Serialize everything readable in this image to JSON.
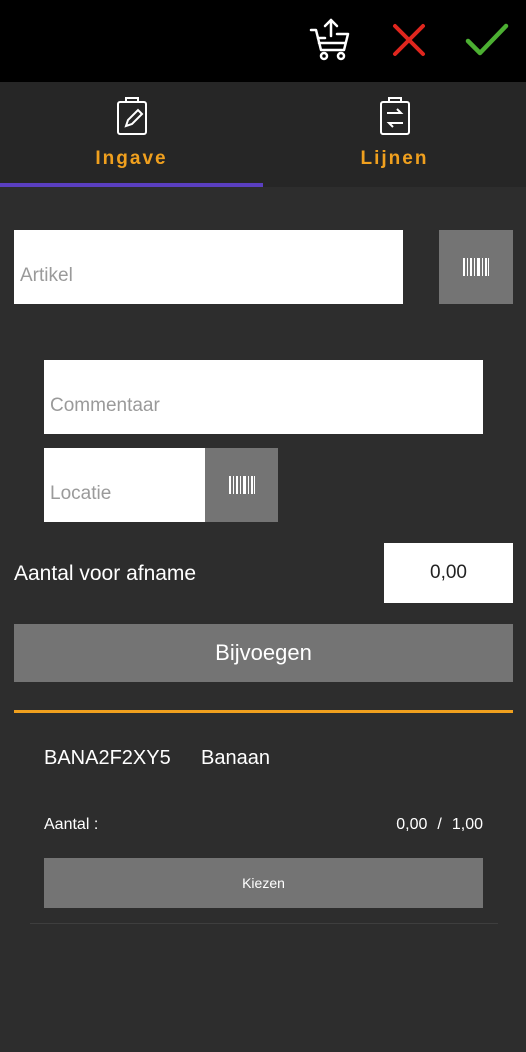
{
  "toolbar": {
    "upload_icon": "cart-upload-icon",
    "cancel_icon": "close-icon",
    "confirm_icon": "checkmark-icon",
    "cancel_color": "#e0261e",
    "confirm_color": "#4caf32"
  },
  "tabs": [
    {
      "label": "Ingave",
      "icon": "clipboard-edit-icon",
      "active": true
    },
    {
      "label": "Lijnen",
      "icon": "clipboard-transfer-icon",
      "active": false
    }
  ],
  "form": {
    "artikel_placeholder": "Artikel",
    "artikel_value": "",
    "commentaar_placeholder": "Commentaar",
    "commentaar_value": "",
    "locatie_placeholder": "Locatie",
    "locatie_value": "",
    "qty_label": "Aantal voor afname",
    "qty_value": "0,00",
    "add_button": "Bijvoegen",
    "scan_icon": "barcode-icon"
  },
  "line": {
    "code": "BANA2F2XY5",
    "name": "Banaan",
    "aantal_label": "Aantal :",
    "aantal_current": "0,00",
    "aantal_sep": "/",
    "aantal_total": "1,00",
    "choose_button": "Kiezen"
  },
  "colors": {
    "accent": "#f0a01e",
    "tab_indicator": "#5a3fc0",
    "button_bg": "#747474",
    "background": "#2d2d2d"
  }
}
